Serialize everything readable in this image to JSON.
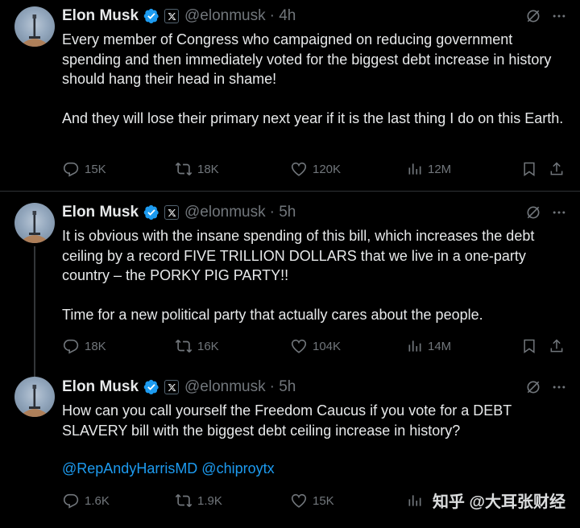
{
  "tweets": [
    {
      "name": "Elon Musk",
      "handle": "@elonmusk",
      "time": "· 4h",
      "text": "Every member of Congress who campaigned on reducing government spending and then immediately voted for the biggest debt increase in history should hang their head in shame!\n\nAnd they will lose their primary next year if it is the last thing I do on this Earth.",
      "mentions": "",
      "replies": "15K",
      "reposts": "18K",
      "likes": "120K",
      "views": "12M"
    },
    {
      "name": "Elon Musk",
      "handle": "@elonmusk",
      "time": "· 5h",
      "text": "It is obvious with the insane spending of this bill, which increases the debt ceiling by a record FIVE TRILLION DOLLARS that we live in a one-party country – the PORKY PIG PARTY!!\n\nTime for a new political party that actually cares about the people.",
      "mentions": "",
      "replies": "18K",
      "reposts": "16K",
      "likes": "104K",
      "views": "14M"
    },
    {
      "name": "Elon Musk",
      "handle": "@elonmusk",
      "time": "· 5h",
      "text": "How can you call yourself the Freedom Caucus if you vote for a DEBT SLAVERY bill with the biggest debt ceiling increase in history?",
      "mentions": "@RepAndyHarrisMD @chiproytx",
      "replies": "1.6K",
      "reposts": "1.9K",
      "likes": "15K",
      "views": ""
    }
  ],
  "watermark": {
    "text": "知乎 @大耳张财经"
  },
  "colors": {
    "background": "#000000",
    "text": "#e7e9ea",
    "muted": "#71767b",
    "accent": "#1d9bf0",
    "divider": "#2f3336"
  },
  "icons": [
    "verified-badge-icon",
    "x-affiliate-icon",
    "grok-icon",
    "more-icon",
    "reply-icon",
    "repost-icon",
    "like-icon",
    "views-icon",
    "bookmark-icon",
    "share-icon"
  ]
}
